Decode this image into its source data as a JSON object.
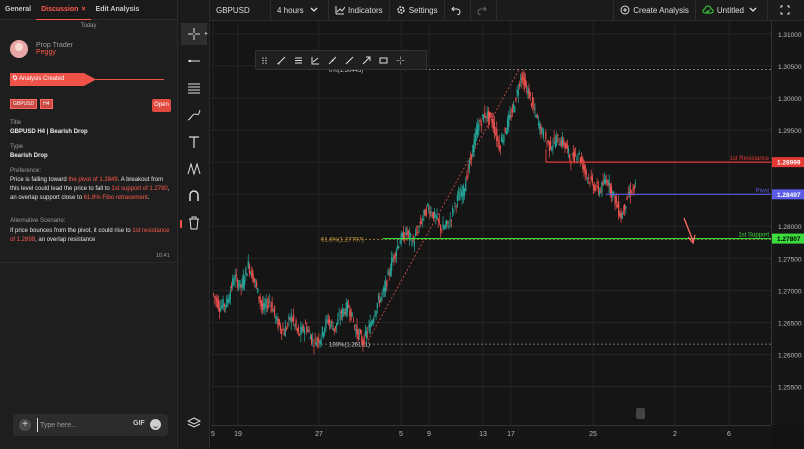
{
  "left_panel": {
    "tabs": [
      {
        "label": "General",
        "active": false
      },
      {
        "label": "Discussion",
        "active": true
      },
      {
        "label": "Edit Analysis",
        "active": false
      }
    ],
    "close_glyph": "×",
    "today_label": "Today",
    "author": {
      "role": "Prop Trader",
      "name": "Peggy"
    },
    "analysis_created_label": "Analysis Created",
    "badges": [
      "GBPUSD",
      "H4"
    ],
    "open_button": "Open",
    "title_label": "Title",
    "title_value": "GBPUSD H4 | Bearish Drop",
    "type_label": "Type",
    "type_value": "Bearish Drop",
    "preference_label": "Preference:",
    "preference_parts": [
      {
        "text": "Price is falling toward ",
        "hl": false
      },
      {
        "text": "the pivot of 1.2849",
        "hl": true
      },
      {
        "text": ". A breakout from this level could lead the price to fall to ",
        "hl": false
      },
      {
        "text": "1st support of 1.2780",
        "hl": true
      },
      {
        "text": ", an overlap support close to ",
        "hl": false
      },
      {
        "text": "61.8% Fibo retracement",
        "hl": true
      },
      {
        "text": ".",
        "hl": false
      }
    ],
    "alt_label": "Alternative Scenario:",
    "alt_parts": [
      {
        "text": "If price bounces from the pivot, it could rise to ",
        "hl": false
      },
      {
        "text": "1st resistance of 1.2899",
        "hl": true
      },
      {
        "text": ", an overlap resistance",
        "hl": false
      }
    ],
    "time": "10:41",
    "input_placeholder": "Type here...",
    "gif_label": "GIF"
  },
  "toolbar": {
    "symbol": "GBPUSD",
    "timeframe": "4 hours",
    "indicators": "Indicators",
    "settings": "Settings",
    "create_analysis": "Create Analysis",
    "title": "Untitled"
  },
  "colors": {
    "accent": "#ef5248",
    "up_candle": "#26a69a",
    "down_candle": "#ef5350",
    "resistance": "#e53935",
    "pivot": "#5c5ce6",
    "support": "#3ddc3d",
    "fib": "#c89b3c"
  },
  "chart_data": {
    "type": "candlestick",
    "symbol": "GBPUSD",
    "timeframe": "H4",
    "ylim": [
      1.249,
      1.312
    ],
    "y_ticks": [
      "1.31000",
      "1.30500",
      "1.30000",
      "1.29500",
      "1.29000",
      "1.28500",
      "1.28000",
      "1.27500",
      "1.27000",
      "1.26500",
      "1.26000",
      "1.25500"
    ],
    "x_ticks": [
      "5",
      "19",
      "27",
      "5",
      "9",
      "13",
      "17",
      "25",
      "2",
      "6"
    ],
    "levels": [
      {
        "name": "1st Resistance",
        "value": 1.28999,
        "label": "1.28999"
      },
      {
        "name": "Pivot",
        "value": 1.28497,
        "label": "1.28497"
      },
      {
        "name": "1st Support",
        "value": 1.27807,
        "label": "1.27807"
      }
    ],
    "fib": [
      {
        "label": "0%(1.30443)",
        "value": 1.30443
      },
      {
        "label": "61.8%(1.27797)",
        "value": 1.27797
      },
      {
        "label": "100%(1.26161)",
        "value": 1.26161
      }
    ],
    "path": [
      1.2695,
      1.2675,
      1.268,
      1.272,
      1.2705,
      1.274,
      1.271,
      1.267,
      1.2685,
      1.265,
      1.2635,
      1.266,
      1.263,
      1.2645,
      1.262,
      1.2625,
      1.2655,
      1.264,
      1.2665,
      1.2675,
      1.2638,
      1.262,
      1.2645,
      1.268,
      1.27,
      1.2745,
      1.2775,
      1.279,
      1.2775,
      1.2805,
      1.283,
      1.2815,
      1.2795,
      1.2805,
      1.284,
      1.2855,
      1.2905,
      1.2955,
      1.2975,
      1.2965,
      1.2925,
      1.2955,
      1.2985,
      1.3035,
      1.301,
      1.2975,
      1.2945,
      1.2925,
      1.2935,
      1.293,
      1.2905,
      1.2915,
      1.2885,
      1.2865,
      1.2855,
      1.2875,
      1.2845,
      1.2815,
      1.285,
      1.286
    ]
  }
}
